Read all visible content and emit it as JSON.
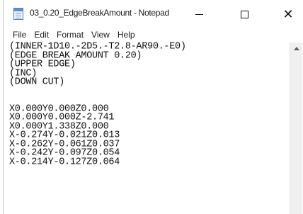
{
  "window": {
    "title": "03_0.20_EdgeBreakAmount - Notepad",
    "close_glyph": "✕"
  },
  "menu": [
    "File",
    "Edit",
    "Format",
    "View",
    "Help"
  ],
  "editor": {
    "lines": [
      "(INNER-1D10.-2D5.-T2.8-AR90.-E0)",
      "(EDGE BREAK AMOUNT 0.20)",
      "(UPPER EDGE)",
      "(INC)",
      "(DOWN CUT)",
      "",
      "",
      "X0.000Y0.000Z0.000",
      "X0.000Y0.000Z-2.741",
      "X0.000Y1.338Z0.000",
      "X-0.274Y-0.021Z0.013",
      "X-0.262Y-0.061Z0.037",
      "X-0.242Y-0.097Z0.054",
      "X-0.214Y-0.127Z0.064"
    ]
  },
  "icons": {
    "app": "notepad-icon",
    "minimize": "minimize-icon",
    "maximize": "maximize-icon",
    "close": "close-icon",
    "scroll_up": "scroll-up-arrow-icon"
  }
}
